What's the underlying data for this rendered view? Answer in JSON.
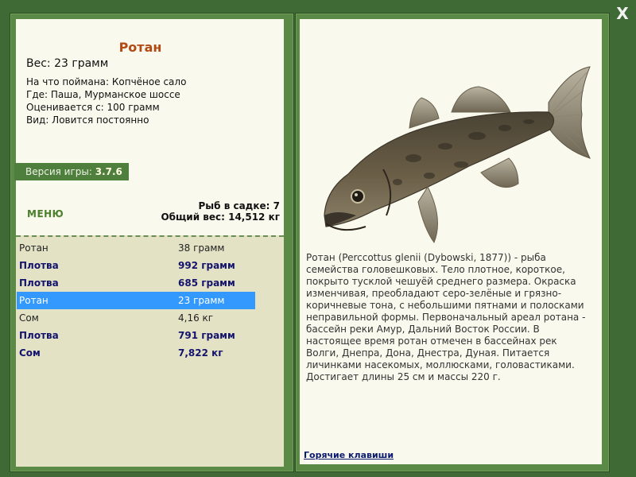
{
  "window": {
    "close_glyph": "X"
  },
  "fish": {
    "title": "Ротан",
    "weight_line": "Вес: 23 грамм",
    "info": [
      "На что поймана: Копчёное сало",
      "Где: Паша, Мурманское шоссе",
      "Оценивается с: 100 грамм",
      "Вид: Ловится постоянно"
    ],
    "image_icon": "rotan-fish-photo",
    "description": "Ротан (Perccottus glenii (Dybowski, 1877)) - рыба семейства головешковых. Тело плотное, короткое, покрыто тусклой чешуёй среднего размера. Окраска изменчивая, преобладают серо-зелёные и грязно-коричневые тона, с небольшими пятнами и полосками неправильной формы. Первоначальный ареал ротана - бассейн реки Амур, Дальний Восток России. В настоящее время ротан отмечен в бассейнах рек Волги, Днепра, Дона, Днестра, Дуная. Питается личинками насекомых, моллюсками, головастиками. Достигает длины 25 см и массы 220 г."
  },
  "version": {
    "label": "Версия игры:",
    "value": "3.7.6"
  },
  "menu_label": "МЕНЮ",
  "cage": {
    "count_line": "Рыб в садке: 7",
    "total_line": "Общий вес: 14,512 кг"
  },
  "catches": [
    {
      "name": "Ротан",
      "weight": "38 грамм",
      "big": false,
      "selected": false
    },
    {
      "name": "Плотва",
      "weight": "992 грамм",
      "big": true,
      "selected": false
    },
    {
      "name": "Плотва",
      "weight": "685 грамм",
      "big": true,
      "selected": false
    },
    {
      "name": "Ротан",
      "weight": "23 грамм",
      "big": false,
      "selected": true
    },
    {
      "name": "Сом",
      "weight": "4,16 кг",
      "big": false,
      "selected": false
    },
    {
      "name": "Плотва",
      "weight": "791 грамм",
      "big": true,
      "selected": false
    },
    {
      "name": "Сом",
      "weight": "7,822 кг",
      "big": true,
      "selected": false
    }
  ],
  "hotkeys_label": "Горячие клавиши",
  "colors": {
    "background": "#3f6a35",
    "card": "#faf9ed",
    "list": "#e4e2c4",
    "title": "#b24a14",
    "selection": "#3399ff",
    "big_catch": "#13136e"
  }
}
